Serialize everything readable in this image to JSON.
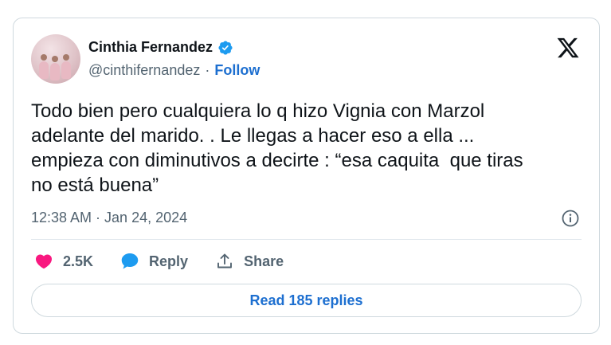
{
  "author": {
    "display_name": "Cinthia Fernandez",
    "handle": "@cinthifernandez",
    "separator": "·",
    "follow_label": "Follow"
  },
  "tweet": {
    "text": "Todo bien pero cualquiera lo q hizo Vignia con Marzol\nadelante del marido. . Le llegas a hacer eso a ella ...\nempieza con diminutivos a decirte : “esa caquita  que tiras\nno está buena”",
    "timestamp": "12:38 AM · Jan 24, 2024"
  },
  "actions": {
    "like_count": "2.5K",
    "reply_label": "Reply",
    "share_label": "Share"
  },
  "read_replies_label": "Read 185 replies",
  "icons": {
    "verified": "verified-badge-icon",
    "brand": "x-logo-icon",
    "info": "info-icon",
    "like": "heart-icon",
    "reply": "speech-bubble-icon",
    "share": "share-upload-icon"
  },
  "colors": {
    "accent": "#1d6fd0",
    "verified": "#1d9bf0",
    "like": "#f91880",
    "muted": "#536471",
    "text": "#0f1419",
    "border": "#cfd9de"
  }
}
